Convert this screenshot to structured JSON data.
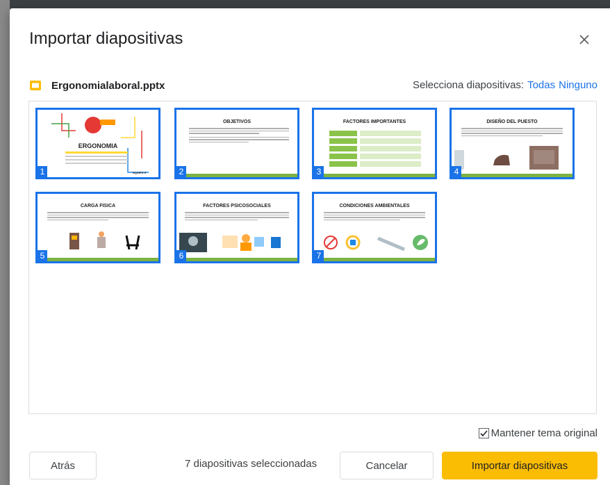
{
  "dialog": {
    "title": "Importar diapositivas",
    "close_icon": "close-icon"
  },
  "file": {
    "name": "Ergonomialaboral.pptx",
    "icon": "slides-file-icon",
    "icon_color": "#fbbc04"
  },
  "selection": {
    "label": "Selecciona diapositivas:",
    "all": "Todas",
    "none": "Ninguno"
  },
  "slides": [
    {
      "number": "1",
      "title": "ERGONOMIA",
      "footer": "EQUIPO 5"
    },
    {
      "number": "2",
      "title": "OBJETIVOS"
    },
    {
      "number": "3",
      "title": "FACTORES IMPORTANTES"
    },
    {
      "number": "4",
      "title": "DISEÑO DEL PUESTO"
    },
    {
      "number": "5",
      "title": "CARGA FISICA"
    },
    {
      "number": "6",
      "title": "FACTORES PSICOSOCIALES"
    },
    {
      "number": "7",
      "title": "CONDICIONES AMBIENTALES"
    }
  ],
  "keep_theme": {
    "label": "Mantener tema original",
    "checked": true
  },
  "footer": {
    "back": "Atrás",
    "count": "7 diapositivas seleccionadas",
    "cancel": "Cancelar",
    "import": "Importar diapositivas"
  },
  "colors": {
    "accent": "#1a73e8",
    "primary_button": "#fbbc04",
    "slide_footer": "#7cb342"
  }
}
